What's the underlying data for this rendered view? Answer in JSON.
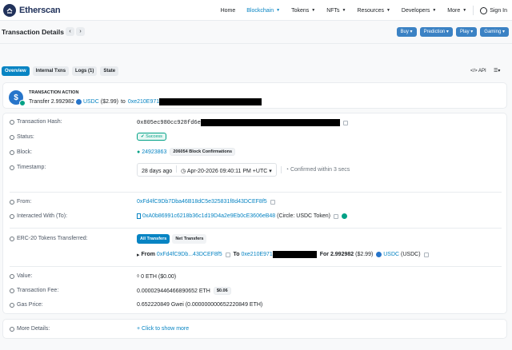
{
  "brand": {
    "name": "Etherscan"
  },
  "nav": {
    "items": [
      {
        "label": "Home",
        "caret": false,
        "active": false
      },
      {
        "label": "Blockchain",
        "caret": true,
        "active": true
      },
      {
        "label": "Tokens",
        "caret": true,
        "active": false
      },
      {
        "label": "NFTs",
        "caret": true,
        "active": false
      },
      {
        "label": "Resources",
        "caret": true,
        "active": false
      },
      {
        "label": "Developers",
        "caret": true,
        "active": false
      },
      {
        "label": "More",
        "caret": true,
        "active": false
      }
    ],
    "signin": "Sign In"
  },
  "header": {
    "title": "Transaction Details",
    "buttons": [
      "Buy",
      "Prediction",
      "Play",
      "Gaming"
    ]
  },
  "tabs": [
    {
      "label": "Overview",
      "active": true
    },
    {
      "label": "Internal Txns",
      "active": false
    },
    {
      "label": "Logs (1)",
      "active": false
    },
    {
      "label": "State",
      "active": false
    }
  ],
  "api_label": "API",
  "action": {
    "title": "TRANSACTION ACTION",
    "prefix": "Transfer 2.992982",
    "token": "USDC",
    "usd": "($2.99)",
    "to_word": "to",
    "to_addr": "0xe210E971"
  },
  "details": {
    "hash": {
      "label": "Transaction Hash:",
      "value": "0x805ec980cc928fd6e"
    },
    "status": {
      "label": "Status:",
      "value": "Success"
    },
    "block": {
      "label": "Block:",
      "value": "24923863",
      "confirmations": "206054 Block Confirmations"
    },
    "timestamp": {
      "label": "Timestamp:",
      "ago": "28 days ago",
      "date": "Apr-20-2026 09:40:11 PM +UTC",
      "confirmed": "Confirmed within 3 secs"
    },
    "from": {
      "label": "From:",
      "value": "0xFd4fC9Db7Dba46B18dC5e325831f8d43DCEF8f5"
    },
    "interacted": {
      "label": "Interacted With (To):",
      "value": "0xA0b86991c6218b36c1d19D4a2e9Eb0cE3606eB48",
      "name": "(Circle: USDC Token)"
    },
    "erc20": {
      "label": "ERC-20 Tokens Transferred:",
      "pills": [
        "All Transfers",
        "Net Transfers"
      ],
      "from_word": "From",
      "from": "0xFd4fC9Db...43DCEF8f5",
      "to_word": "To",
      "to": "0xe210E971",
      "for_text": "For 2.992982",
      "usd": "($2.99)",
      "token": "USDC",
      "token_sym": "(USDC)"
    },
    "value": {
      "label": "Value:",
      "value": "0 ETH ($0.00)"
    },
    "fee": {
      "label": "Transaction Fee:",
      "value": "0.000029446466890652 ETH",
      "usd": "$0.06"
    },
    "gas": {
      "label": "Gas Price:",
      "value": "0.652220849 Gwei (0.000000000652220849 ETH)"
    }
  },
  "more": {
    "label": "More Details:",
    "link": "+ Click to show more"
  }
}
